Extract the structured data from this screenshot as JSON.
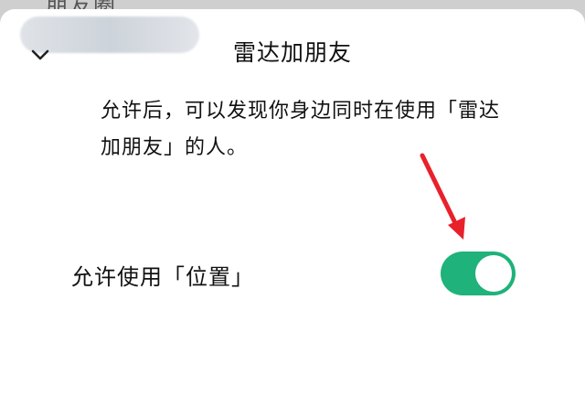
{
  "background_text": "朋友圈",
  "sheet": {
    "title": "雷达加朋友",
    "description": "允许后，可以发现你身边同时在使用「雷达加朋友」的人。"
  },
  "permission": {
    "label": "允许使用「位置」",
    "enabled": true
  },
  "colors": {
    "toggle_on": "#1fb27a",
    "arrow": "#e8212b"
  },
  "icons": {
    "collapse": "chevron-down-icon",
    "annotation": "red-arrow-icon"
  }
}
